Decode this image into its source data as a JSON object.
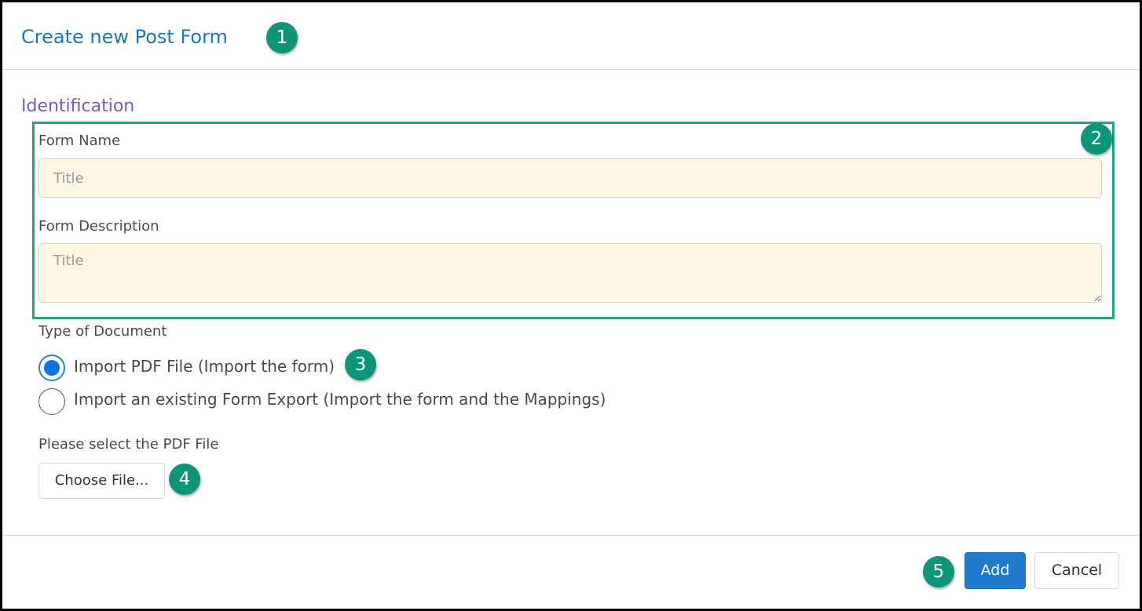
{
  "dialog": {
    "title": "Create new Post Form"
  },
  "identification": {
    "section_title": "Identification",
    "form_name_label": "Form Name",
    "form_name_placeholder": "Title",
    "form_description_label": "Form Description",
    "form_description_placeholder": "Title"
  },
  "document_type": {
    "label": "Type of Document",
    "options": [
      {
        "label": "Import PDF File (Import the form)",
        "checked": true
      },
      {
        "label": "Import an existing Form Export (Import the form and the Mappings)",
        "checked": false
      }
    ]
  },
  "file_picker": {
    "label": "Please select the PDF File",
    "button_label": "Choose File..."
  },
  "footer": {
    "add_label": "Add",
    "cancel_label": "Cancel"
  },
  "callouts": [
    "1",
    "2",
    "3",
    "4",
    "5"
  ],
  "colors": {
    "title": "#1f73b7",
    "section_title": "#7b5bb5",
    "callout": "#0e9479",
    "highlight_border": "#21a58a",
    "input_background": "#fdf6e3",
    "primary_button": "#1f7bcd",
    "radio_selected": "#0a72e6"
  }
}
